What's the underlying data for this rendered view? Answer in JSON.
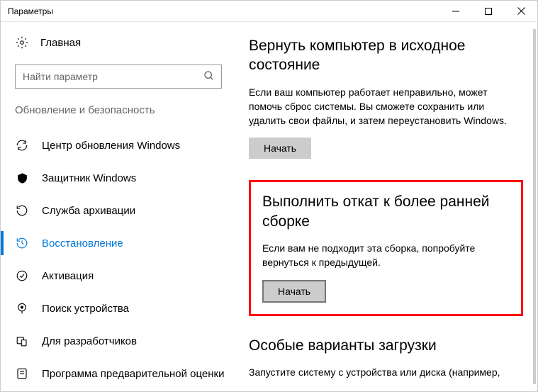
{
  "window": {
    "title": "Параметры"
  },
  "sidebar": {
    "home_label": "Главная",
    "search_placeholder": "Найти параметр",
    "group_title": "Обновление и безопасность",
    "items": [
      {
        "label": "Центр обновления Windows"
      },
      {
        "label": "Защитник Windows"
      },
      {
        "label": "Служба архивации"
      },
      {
        "label": "Восстановление"
      },
      {
        "label": "Активация"
      },
      {
        "label": "Поиск устройства"
      },
      {
        "label": "Для разработчиков"
      },
      {
        "label": "Программа предварительной оценки"
      }
    ]
  },
  "main": {
    "reset": {
      "title": "Вернуть компьютер в исходное состояние",
      "desc": "Если ваш компьютер работает неправильно, может помочь сброс системы. Вы сможете сохранить или удалить свои файлы, и затем переустановить Windows.",
      "button": "Начать"
    },
    "rollback": {
      "title": "Выполнить откат к более ранней сборке",
      "desc": "Если вам не подходит эта сборка, попробуйте вернуться к предыдущей.",
      "button": "Начать"
    },
    "advanced": {
      "title": "Особые варианты загрузки",
      "desc": "Запустите систему с устройства или диска (например,"
    }
  }
}
